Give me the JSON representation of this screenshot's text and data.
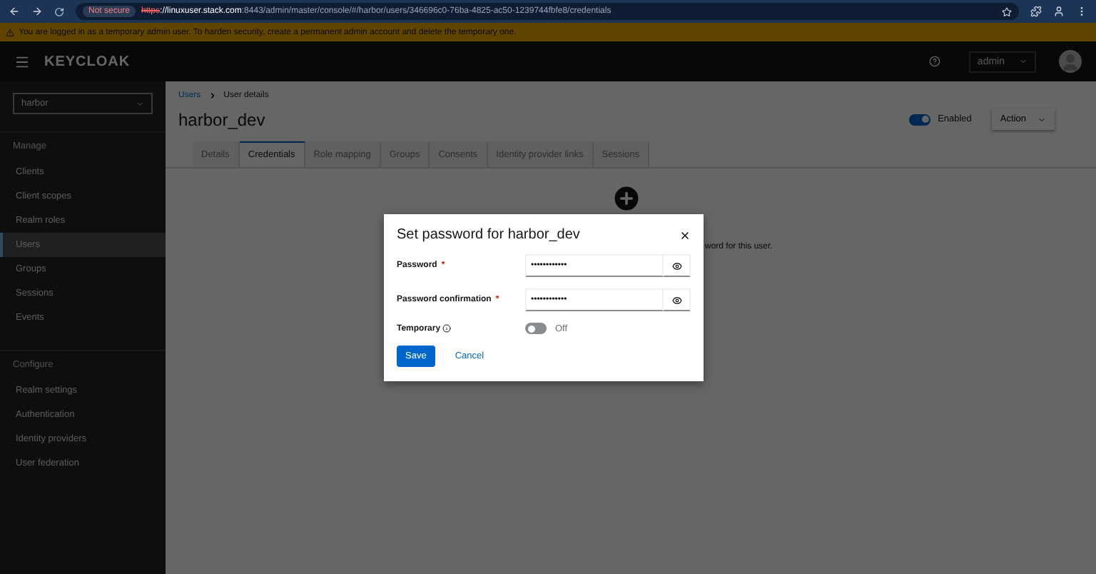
{
  "browser": {
    "security": "Not secure",
    "url_scheme": "https",
    "url_host": "://linuxuser.stack.com",
    "url_rest": ":8443/admin/master/console/#/harbor/users/346696c0-76ba-4825-ac50-1239744fbfe8/credentials"
  },
  "banner": {
    "text": "You are logged in as a temporary admin user. To harden security, create a permanent admin account and delete the temporary one."
  },
  "header": {
    "logo": "KEYCLOAK",
    "user": "admin"
  },
  "sidebar": {
    "realm": "harbor",
    "sections": [
      {
        "title": "Manage",
        "items": [
          {
            "label": "Clients",
            "selected": false
          },
          {
            "label": "Client scopes",
            "selected": false
          },
          {
            "label": "Realm roles",
            "selected": false
          },
          {
            "label": "Users",
            "selected": true
          },
          {
            "label": "Groups",
            "selected": false
          },
          {
            "label": "Sessions",
            "selected": false
          },
          {
            "label": "Events",
            "selected": false
          }
        ]
      },
      {
        "title": "Configure",
        "items": [
          {
            "label": "Realm settings",
            "selected": false
          },
          {
            "label": "Authentication",
            "selected": false
          },
          {
            "label": "Identity providers",
            "selected": false
          },
          {
            "label": "User federation",
            "selected": false
          }
        ]
      }
    ]
  },
  "breadcrumb": [
    "Users",
    "User details"
  ],
  "page": {
    "title": "harbor_dev",
    "enabled": {
      "label": "Enabled",
      "on": true
    },
    "action": "Action"
  },
  "tabs": [
    {
      "label": "Details",
      "selected": false
    },
    {
      "label": "Credentials",
      "selected": true
    },
    {
      "label": "Role mapping",
      "selected": false
    },
    {
      "label": "Groups",
      "selected": false
    },
    {
      "label": "Consents",
      "selected": false
    },
    {
      "label": "Identity provider links",
      "selected": false
    },
    {
      "label": "Sessions",
      "selected": false
    }
  ],
  "empty_state": {
    "text": "word for this user."
  },
  "modal": {
    "title": "Set password for harbor_dev",
    "fields": [
      {
        "label": "Password",
        "required_mark": "*",
        "value": "••••••••••••"
      },
      {
        "label": "Password confirmation",
        "required_mark": "*",
        "value": "••••••••••••"
      }
    ],
    "temporary": {
      "label": "Temporary",
      "on": false,
      "state_label": "Off"
    },
    "buttons": [
      {
        "label": "Save",
        "kind": "primary"
      },
      {
        "label": "Cancel",
        "kind": "link"
      }
    ]
  }
}
